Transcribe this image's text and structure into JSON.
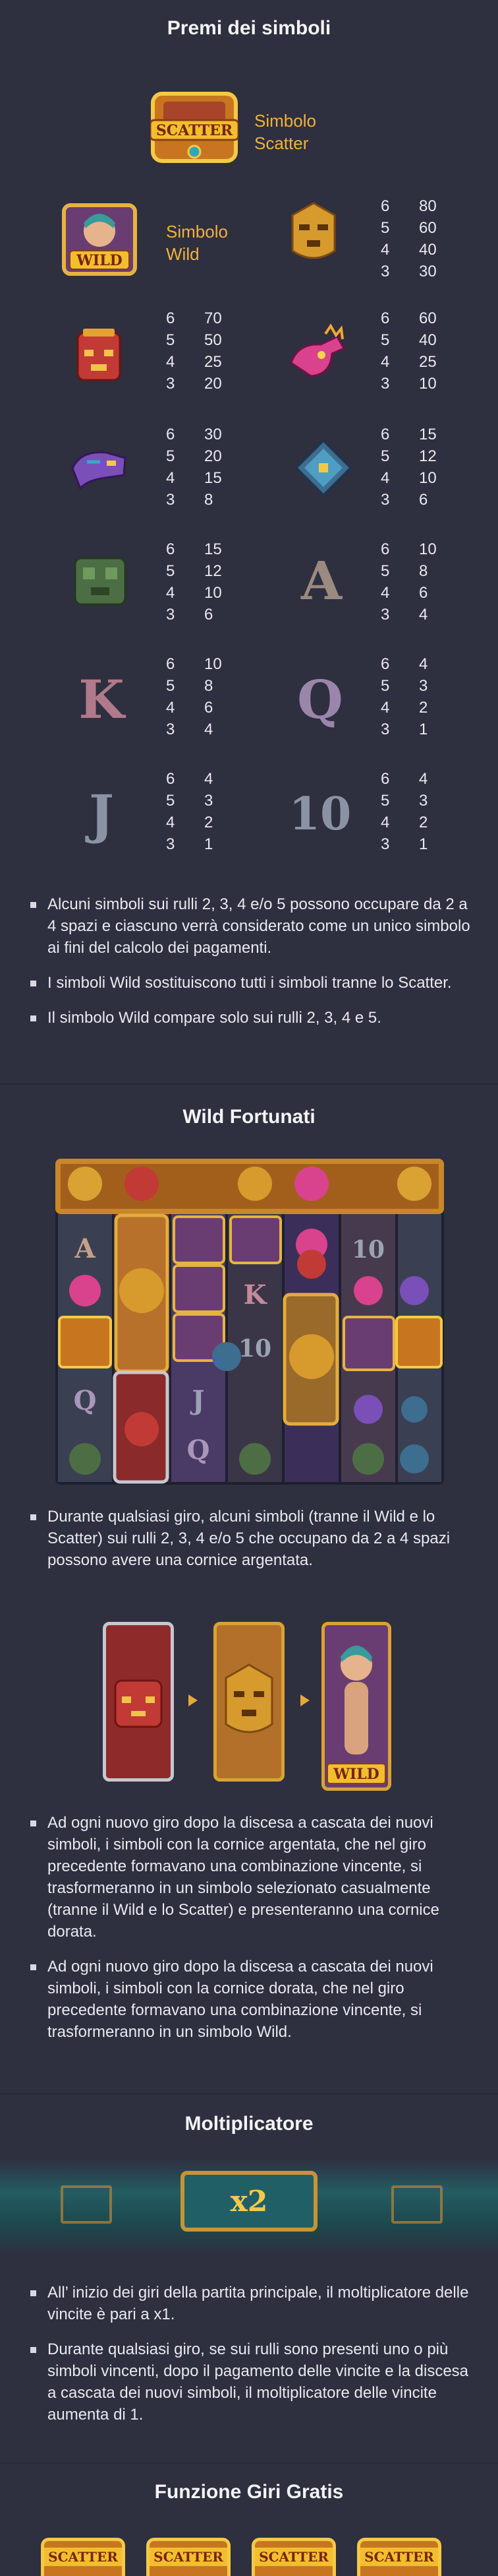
{
  "sections": {
    "symbols_title": "Premi dei simboli",
    "wild_title": "Wild Fortunati",
    "multiplier_title": "Moltiplicatore",
    "free_spins_title": "Funzione Giri Gratis"
  },
  "scatter": {
    "tile_text": "SCATTER",
    "label_line1": "Simbolo",
    "label_line2": "Scatter"
  },
  "wild": {
    "tile_text": "WILD",
    "label_line1": "Simbolo",
    "label_line2": "Wild"
  },
  "paytables": {
    "yellow_mask": [
      [
        "6",
        "80"
      ],
      [
        "5",
        "60"
      ],
      [
        "4",
        "40"
      ],
      [
        "3",
        "30"
      ]
    ],
    "red_mask": [
      [
        "6",
        "70"
      ],
      [
        "5",
        "50"
      ],
      [
        "4",
        "25"
      ],
      [
        "3",
        "20"
      ]
    ],
    "pink_bird": [
      [
        "6",
        "60"
      ],
      [
        "5",
        "40"
      ],
      [
        "4",
        "25"
      ],
      [
        "3",
        "10"
      ]
    ],
    "purple_snake": [
      [
        "6",
        "30"
      ],
      [
        "5",
        "20"
      ],
      [
        "4",
        "15"
      ],
      [
        "3",
        "8"
      ]
    ],
    "blue_cross": [
      [
        "6",
        "15"
      ],
      [
        "5",
        "12"
      ],
      [
        "4",
        "10"
      ],
      [
        "3",
        "6"
      ]
    ],
    "green_idol": [
      [
        "6",
        "15"
      ],
      [
        "5",
        "12"
      ],
      [
        "4",
        "10"
      ],
      [
        "3",
        "6"
      ]
    ],
    "letter_a": [
      [
        "6",
        "10"
      ],
      [
        "5",
        "8"
      ],
      [
        "4",
        "6"
      ],
      [
        "3",
        "4"
      ]
    ],
    "letter_k": [
      [
        "6",
        "10"
      ],
      [
        "5",
        "8"
      ],
      [
        "4",
        "6"
      ],
      [
        "3",
        "4"
      ]
    ],
    "letter_q": [
      [
        "6",
        "4"
      ],
      [
        "5",
        "3"
      ],
      [
        "4",
        "2"
      ],
      [
        "3",
        "1"
      ]
    ],
    "letter_j": [
      [
        "6",
        "4"
      ],
      [
        "5",
        "3"
      ],
      [
        "4",
        "2"
      ],
      [
        "3",
        "1"
      ]
    ],
    "number_10": [
      [
        "6",
        "4"
      ],
      [
        "5",
        "3"
      ],
      [
        "4",
        "2"
      ],
      [
        "3",
        "1"
      ]
    ]
  },
  "letters": {
    "a": "A",
    "k": "K",
    "q": "Q",
    "j": "J",
    "ten": "10"
  },
  "symbol_rules": [
    "Alcuni simboli sui rulli 2, 3, 4 e/o 5 possono occupare da 2 a 4 spazi e ciascuno verrà considerato come un unico simbolo ai fini del calcolo dei pagamenti.",
    "I simboli Wild sostituiscono tutti i simboli tranne lo Scatter.",
    "Il simbolo Wild compare solo sui rulli 2, 3, 4 e 5."
  ],
  "wild_rules_1": [
    "Durante qualsiasi giro, alcuni simboli (tranne il Wild e lo Scatter) sui rulli 2, 3, 4 e/o 5 che occupano da 2 a 4 spazi possono avere una cornice argentata."
  ],
  "wild_rules_2": [
    "Ad ogni nuovo giro dopo la discesa a cascata dei nuovi simboli, i simboli con la cornice argentata, che nel giro precedente formavano una combinazione vincente, si trasformeranno in un simbolo selezionato casualmente (tranne il Wild e lo Scatter) e presenteranno una cornice dorata.",
    "Ad ogni nuovo giro dopo la discesa a cascata dei nuovi simboli, i simboli con la cornice dorata, che nel giro precedente formavano una combinazione vincente, si trasformeranno in un simbolo Wild."
  ],
  "multiplier": {
    "value": "x2"
  },
  "multiplier_rules": [
    "All’ inizio dei giri della partita principale, il moltiplicatore delle vincite è pari a x1.",
    "Durante qualsiasi giro, se sui rulli sono presenti uno o più simboli vincenti, dopo il pagamento delle vincite e la discesa a cascata dei nuovi simboli, il moltiplicatore delle vincite aumenta di 1."
  ],
  "colors": {
    "background": "#2e2f3f",
    "label_gold": "#f0b23d",
    "gold_frame": "#d8a334",
    "silver_frame": "#c6c7cf"
  }
}
